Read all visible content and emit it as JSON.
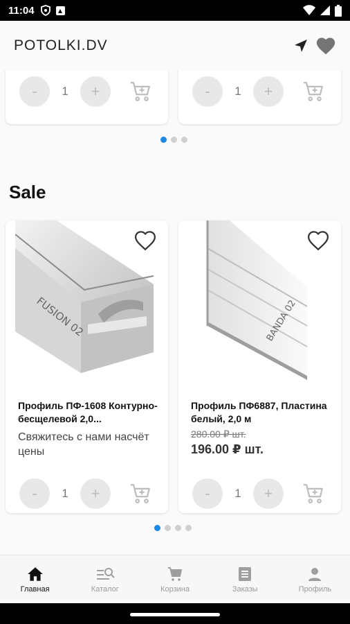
{
  "status": {
    "time": "11:04"
  },
  "appbar": {
    "title": "POTOLKI.DV"
  },
  "top_carousel": {
    "cards": [
      {
        "qty": "1",
        "minus": "-",
        "plus": "+"
      },
      {
        "qty": "1",
        "minus": "-",
        "plus": "+"
      }
    ],
    "dots": 3,
    "active_dot": 0
  },
  "sale": {
    "title": "Sale",
    "cards": [
      {
        "name": "Профиль ПФ-1608 Контурно-бесщелевой 2,0...",
        "note": "Свяжитесь с нами насчёт цены",
        "image_text": "FUSION 02",
        "qty": "1",
        "minus": "-",
        "plus": "+"
      },
      {
        "name": "Профиль ПФ6887, Пластина белый, 2,0 м",
        "old_price": "280.00 ₽ шт.",
        "price": "196.00 ₽ шт.",
        "image_text": "BANDA 02",
        "qty": "1",
        "minus": "-",
        "plus": "+"
      }
    ],
    "dots": 4,
    "active_dot": 0
  },
  "nav": {
    "items": [
      {
        "label": "Главная",
        "icon": "home-icon",
        "active": true
      },
      {
        "label": "Каталог",
        "icon": "catalog-search-icon",
        "active": false
      },
      {
        "label": "Корзина",
        "icon": "cart-icon",
        "active": false
      },
      {
        "label": "Заказы",
        "icon": "orders-icon",
        "active": false
      },
      {
        "label": "Профиль",
        "icon": "profile-icon",
        "active": false
      }
    ]
  },
  "colors": {
    "accent": "#1e88e5",
    "muted": "#bdbdbd",
    "text": "#111111"
  }
}
